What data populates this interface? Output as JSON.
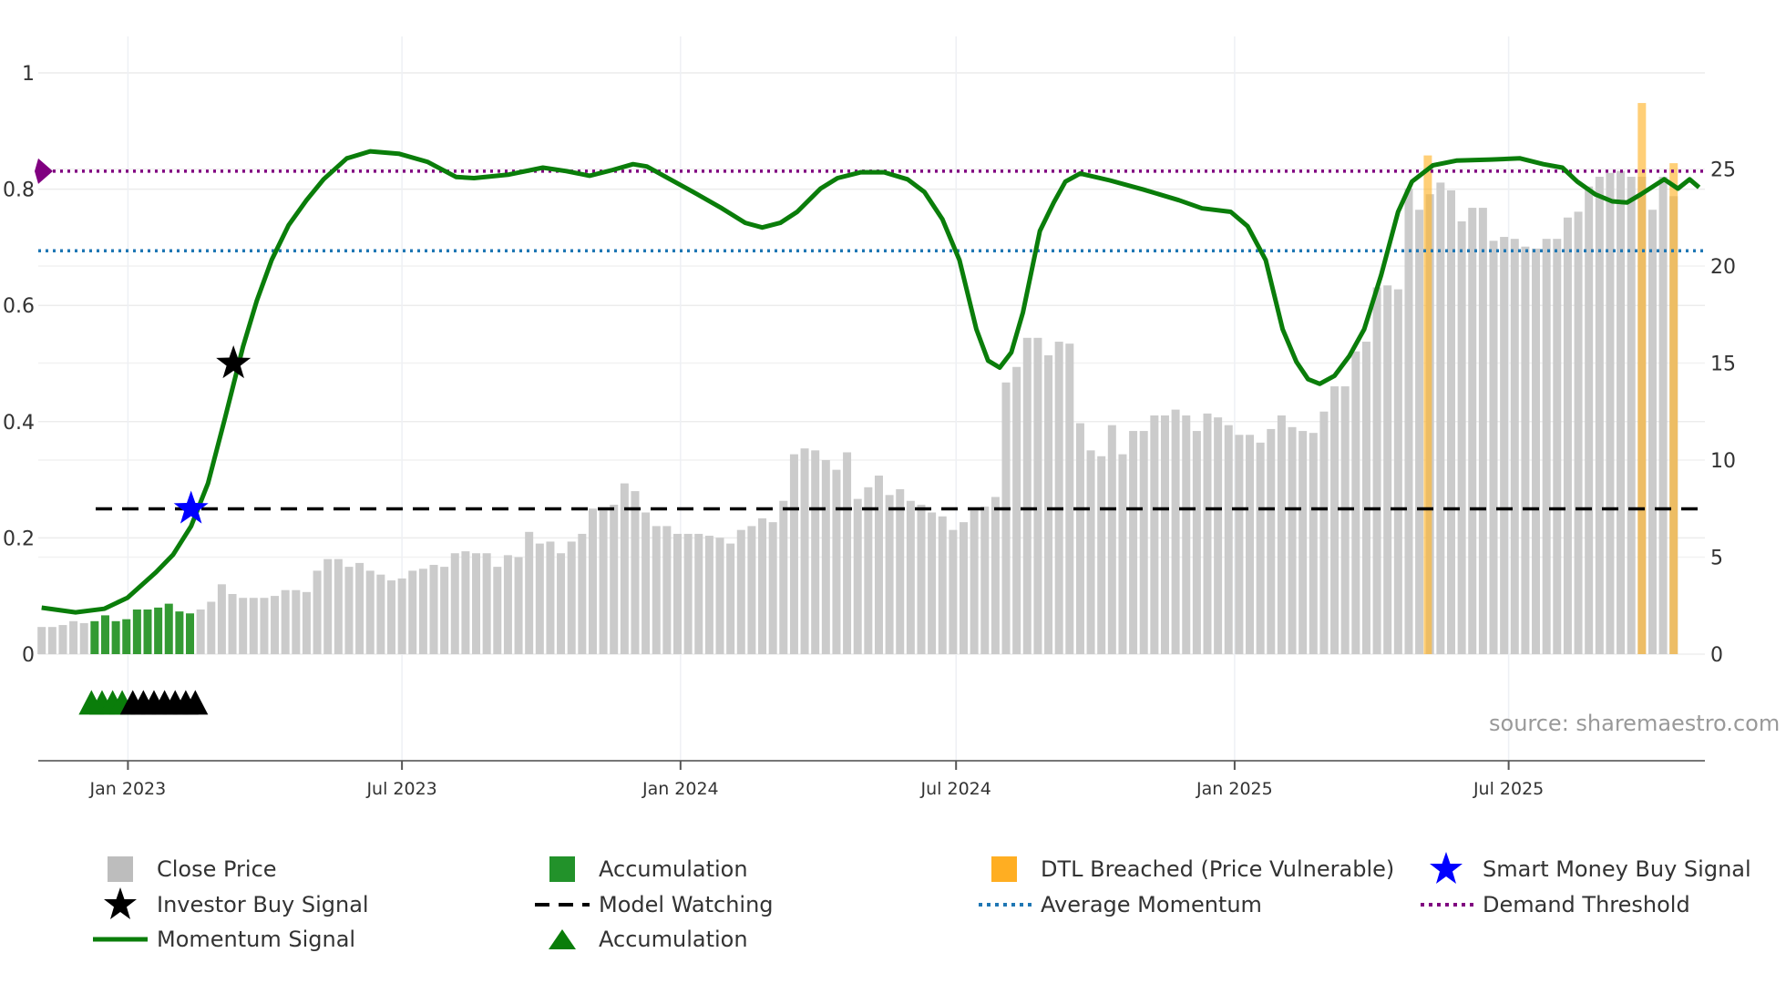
{
  "source": "source: sharemaestro.com",
  "legend": [
    {
      "label": "Close Price",
      "icon": "gray-square",
      "color": "#bdbdbd"
    },
    {
      "label": "Accumulation",
      "icon": "green-square",
      "color": "#22922a"
    },
    {
      "label": "DTL Breached (Price Vulnerable)",
      "icon": "orange-square",
      "color": "#ffae22"
    },
    {
      "label": "Smart Money Buy Signal",
      "icon": "blue-star",
      "color": "#0000ff"
    },
    {
      "label": "Investor Buy Signal",
      "icon": "black-star",
      "color": "#000000"
    },
    {
      "label": "Model Watching",
      "icon": "black-dash",
      "color": "#000000"
    },
    {
      "label": "Average Momentum",
      "icon": "blue-dot-line",
      "color": "#1f77b4"
    },
    {
      "label": "Demand Threshold",
      "icon": "purple-dot-line",
      "color": "#800080"
    },
    {
      "label": "Momentum Signal",
      "icon": "green-line",
      "color": "#0a7d0a"
    },
    {
      "label": "Accumulation",
      "icon": "green-triangle",
      "color": "#0a7d0a"
    }
  ],
  "chart_data": {
    "type": "bar+line",
    "start_date": "2022-11-05",
    "interval": "weekly",
    "x_ticks": [
      {
        "label": "Jan 2023",
        "date": "2023-01-01"
      },
      {
        "label": "Jul 2023",
        "date": "2023-07-01"
      },
      {
        "label": "Jan 2024",
        "date": "2024-01-01"
      },
      {
        "label": "Jul 2024",
        "date": "2024-07-01"
      },
      {
        "label": "Jan 2025",
        "date": "2025-01-01"
      },
      {
        "label": "Jul 2025",
        "date": "2025-07-01"
      }
    ],
    "left_axis": {
      "ylim": [
        -0.18,
        1
      ],
      "ticks": [
        "0",
        "0.2",
        "0.4",
        "0.6",
        "0.8",
        "1"
      ],
      "tick_values": [
        0,
        0.2,
        0.4,
        0.6,
        0.8,
        1
      ]
    },
    "right_axis": {
      "ylim": [
        0,
        30
      ],
      "ticks": [
        "0",
        "5",
        "10",
        "15",
        "20",
        "25"
      ],
      "tick_values": [
        0,
        5,
        10,
        15,
        20,
        25
      ]
    },
    "close_price": [
      1.4,
      1.4,
      1.5,
      1.7,
      1.6,
      1.7,
      2.0,
      1.7,
      1.8,
      2.3,
      2.3,
      2.4,
      2.6,
      2.2,
      2.1,
      2.3,
      2.7,
      3.6,
      3.1,
      2.9,
      2.9,
      2.9,
      3.0,
      3.3,
      3.3,
      3.2,
      4.3,
      4.9,
      4.9,
      4.5,
      4.7,
      4.3,
      4.1,
      3.8,
      3.9,
      4.3,
      4.4,
      4.6,
      4.5,
      5.2,
      5.3,
      5.2,
      5.2,
      4.5,
      5.1,
      5.0,
      6.3,
      5.7,
      5.8,
      5.2,
      5.8,
      6.2,
      7.5,
      7.4,
      7.7,
      8.8,
      8.4,
      7.3,
      6.6,
      6.6,
      6.2,
      6.2,
      6.2,
      6.1,
      6.0,
      5.7,
      6.4,
      6.6,
      7.0,
      6.8,
      7.9,
      10.3,
      10.6,
      10.5,
      10.0,
      9.5,
      10.4,
      8.0,
      8.6,
      9.2,
      8.2,
      8.5,
      7.9,
      7.7,
      7.3,
      7.1,
      6.4,
      6.8,
      7.4,
      7.6,
      8.1,
      14.0,
      14.8,
      16.3,
      16.3,
      15.4,
      16.1,
      16.0,
      11.9,
      10.5,
      10.2,
      11.8,
      10.3,
      11.5,
      11.5,
      12.3,
      12.3,
      12.6,
      12.3,
      11.5,
      12.4,
      12.2,
      11.8,
      11.3,
      11.3,
      10.9,
      11.6,
      12.3,
      11.7,
      11.5,
      11.4,
      12.5,
      13.8,
      13.8,
      15.6,
      16.1,
      18.9,
      19.0,
      18.8,
      24.0,
      22.9,
      23.7,
      24.3,
      23.9,
      22.3,
      23.0,
      23.0,
      21.3,
      21.5,
      21.4,
      21.0,
      20.9,
      21.4,
      21.4,
      22.5,
      22.8,
      24.1,
      24.6,
      24.8,
      24.9,
      24.6,
      24.6,
      22.9,
      24.6,
      23.6
    ],
    "accumulation_bar_indices": [
      5,
      6,
      7,
      8,
      9,
      10,
      11,
      12,
      13,
      14
    ],
    "dtl_breached": [
      {
        "week": 130.8,
        "value": 25.7
      },
      {
        "week": 151.0,
        "value": 28.4
      },
      {
        "week": 154.0,
        "value": 25.3
      }
    ],
    "momentum_signal": [
      [
        0,
        0.08
      ],
      [
        3.2,
        0.072
      ],
      [
        5.9,
        0.078
      ],
      [
        8.1,
        0.097
      ],
      [
        10.8,
        0.141
      ],
      [
        12.4,
        0.171
      ],
      [
        14.1,
        0.22
      ],
      [
        15.7,
        0.294
      ],
      [
        17.3,
        0.406
      ],
      [
        19.0,
        0.529
      ],
      [
        20.3,
        0.608
      ],
      [
        21.7,
        0.678
      ],
      [
        23.3,
        0.738
      ],
      [
        25.0,
        0.781
      ],
      [
        26.6,
        0.817
      ],
      [
        28.8,
        0.853
      ],
      [
        31.0,
        0.865
      ],
      [
        33.7,
        0.861
      ],
      [
        36.4,
        0.847
      ],
      [
        39.1,
        0.821
      ],
      [
        40.8,
        0.819
      ],
      [
        44.1,
        0.825
      ],
      [
        47.3,
        0.837
      ],
      [
        49.5,
        0.831
      ],
      [
        51.7,
        0.823
      ],
      [
        53.9,
        0.833
      ],
      [
        55.8,
        0.843
      ],
      [
        57.1,
        0.839
      ],
      [
        59.3,
        0.817
      ],
      [
        61.5,
        0.795
      ],
      [
        64.2,
        0.767
      ],
      [
        66.4,
        0.742
      ],
      [
        68.0,
        0.734
      ],
      [
        69.7,
        0.742
      ],
      [
        71.3,
        0.761
      ],
      [
        73.5,
        0.801
      ],
      [
        75.1,
        0.819
      ],
      [
        77.3,
        0.829
      ],
      [
        79.5,
        0.829
      ],
      [
        81.7,
        0.817
      ],
      [
        83.3,
        0.795
      ],
      [
        85.0,
        0.748
      ],
      [
        86.6,
        0.678
      ],
      [
        88.2,
        0.559
      ],
      [
        89.3,
        0.505
      ],
      [
        90.4,
        0.493
      ],
      [
        91.5,
        0.519
      ],
      [
        92.6,
        0.588
      ],
      [
        94.2,
        0.728
      ],
      [
        95.5,
        0.777
      ],
      [
        96.6,
        0.813
      ],
      [
        98.0,
        0.827
      ],
      [
        100.8,
        0.815
      ],
      [
        104.0,
        0.799
      ],
      [
        107.3,
        0.781
      ],
      [
        109.5,
        0.767
      ],
      [
        112.2,
        0.761
      ],
      [
        113.8,
        0.736
      ],
      [
        115.5,
        0.678
      ],
      [
        117.1,
        0.559
      ],
      [
        118.4,
        0.503
      ],
      [
        119.5,
        0.473
      ],
      [
        120.6,
        0.465
      ],
      [
        122.0,
        0.479
      ],
      [
        123.4,
        0.513
      ],
      [
        124.8,
        0.559
      ],
      [
        126.4,
        0.652
      ],
      [
        128.0,
        0.761
      ],
      [
        129.3,
        0.813
      ],
      [
        131.3,
        0.841
      ],
      [
        133.5,
        0.849
      ],
      [
        136.8,
        0.851
      ],
      [
        139.5,
        0.853
      ],
      [
        141.7,
        0.843
      ],
      [
        143.5,
        0.837
      ],
      [
        144.9,
        0.813
      ],
      [
        146.6,
        0.791
      ],
      [
        148.2,
        0.779
      ],
      [
        149.6,
        0.777
      ],
      [
        150.9,
        0.791
      ],
      [
        153.1,
        0.817
      ],
      [
        154.4,
        0.801
      ],
      [
        155.5,
        0.817
      ],
      [
        156.4,
        0.803
      ]
    ],
    "investor_buy_signal": [
      {
        "week": 18.1,
        "value": 0.5
      }
    ],
    "smart_money_buy_signal": [
      {
        "week": 14.1,
        "value": 0.25
      }
    ],
    "model_watching": {
      "value": 0.25,
      "from_week": 5.1
    },
    "average_momentum": 0.694,
    "demand_threshold": 0.831,
    "accumulation_triangles": {
      "value": -0.09,
      "green_weeks": [
        4.7,
        5.7,
        6.7,
        7.6
      ],
      "black_weeks": [
        8.6,
        9.6,
        10.6,
        11.6,
        12.6,
        13.6,
        14.5
      ]
    }
  }
}
